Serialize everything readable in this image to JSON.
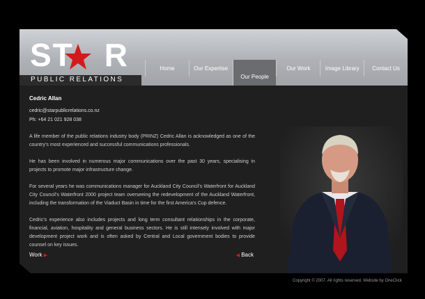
{
  "brand": {
    "name_part1": "ST",
    "name_part2": "R",
    "subtitle": "PUBLIC RELATIONS",
    "accent": "#d21a1a"
  },
  "nav": [
    {
      "label": "Home",
      "active": false
    },
    {
      "label": "Our Expertise",
      "active": false
    },
    {
      "label": "Our People",
      "active": true
    },
    {
      "label": "Our Work",
      "active": false
    },
    {
      "label": "Image Library",
      "active": false
    },
    {
      "label": "Contact Us",
      "active": false
    }
  ],
  "profile": {
    "name": "Cedric Allan",
    "email": "cedric@starpublicrelations.co.nz",
    "phone": "Ph: +64 21 021 928 038",
    "paragraphs": [
      "A life member of the public relations industry body (PRINZ) Cedric Allan is acknowledged as one of the country’s most experienced and successful communications professionals.",
      "He has been involved in numerous major communications over the past 30 years, specialising in projects to promote major infrastructure change.",
      "For several years he was communications manager for Auckland City Council’s Waterfront for Auckland City Council’s Waterfront 2000 project team overseeing the redevelopment of the Auckland Waterfront, including the transformation of the Viaduct Basin in time for the first America’s Cup defence.",
      "Cedric’s experience also includes projects and long term consultant relationships in the corporate, financial, aviation, hospitality and general business sectors. He is still intensely involved with major development project work and is often asked by Central and Local government bodies to provide counsel on key issues."
    ]
  },
  "links": {
    "work": "Work",
    "back": "Back"
  },
  "footer": {
    "copyright": "Copyright © 2007. All rights reserved. Website by OneClick"
  }
}
